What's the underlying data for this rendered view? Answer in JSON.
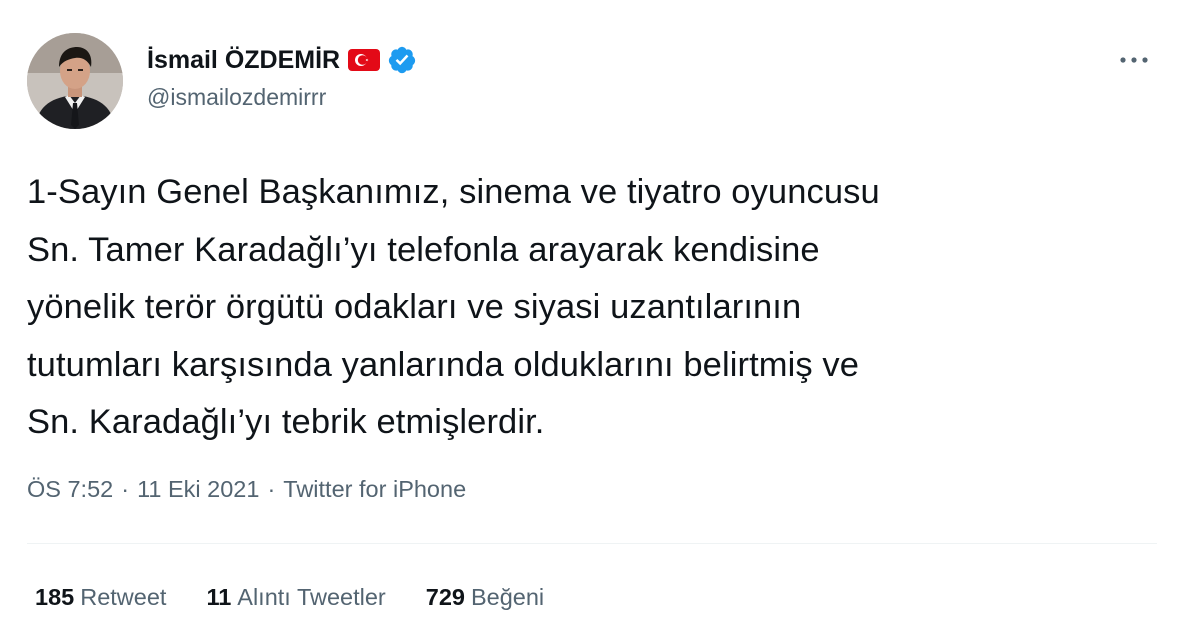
{
  "author": {
    "display_name": "İsmail ÖZDEMİR",
    "handle": "@ismailozdemirrr",
    "flag_icon": "turkey-flag-icon",
    "verified_icon": "verified-badge-icon"
  },
  "colors": {
    "verified_blue": "#1d9bf0",
    "flag_red": "#e30a17",
    "secondary_text": "#536471",
    "primary_text": "#0f1419"
  },
  "tweet": {
    "lines": [
      "1-Sayın Genel Başkanımız, sinema ve tiyatro oyuncusu",
      "Sn. Tamer Karadağlı’yı telefonla arayarak kendisine",
      "yönelik terör örgütü odakları ve siyasi uzantılarının",
      "tutumları karşısında yanlarında olduklarını belirtmiş ve",
      "Sn. Karadağlı’yı tebrik etmişlerdir."
    ],
    "time": "ÖS 7:52",
    "date": "11 Eki 2021",
    "source": "Twitter for iPhone",
    "separator": "·"
  },
  "stats": {
    "retweets": {
      "count": "185",
      "label": "Retweet"
    },
    "quotes": {
      "count": "11",
      "label": "Alıntı Tweetler"
    },
    "likes": {
      "count": "729",
      "label": "Beğeni"
    }
  },
  "more_icon": "more-options-icon"
}
